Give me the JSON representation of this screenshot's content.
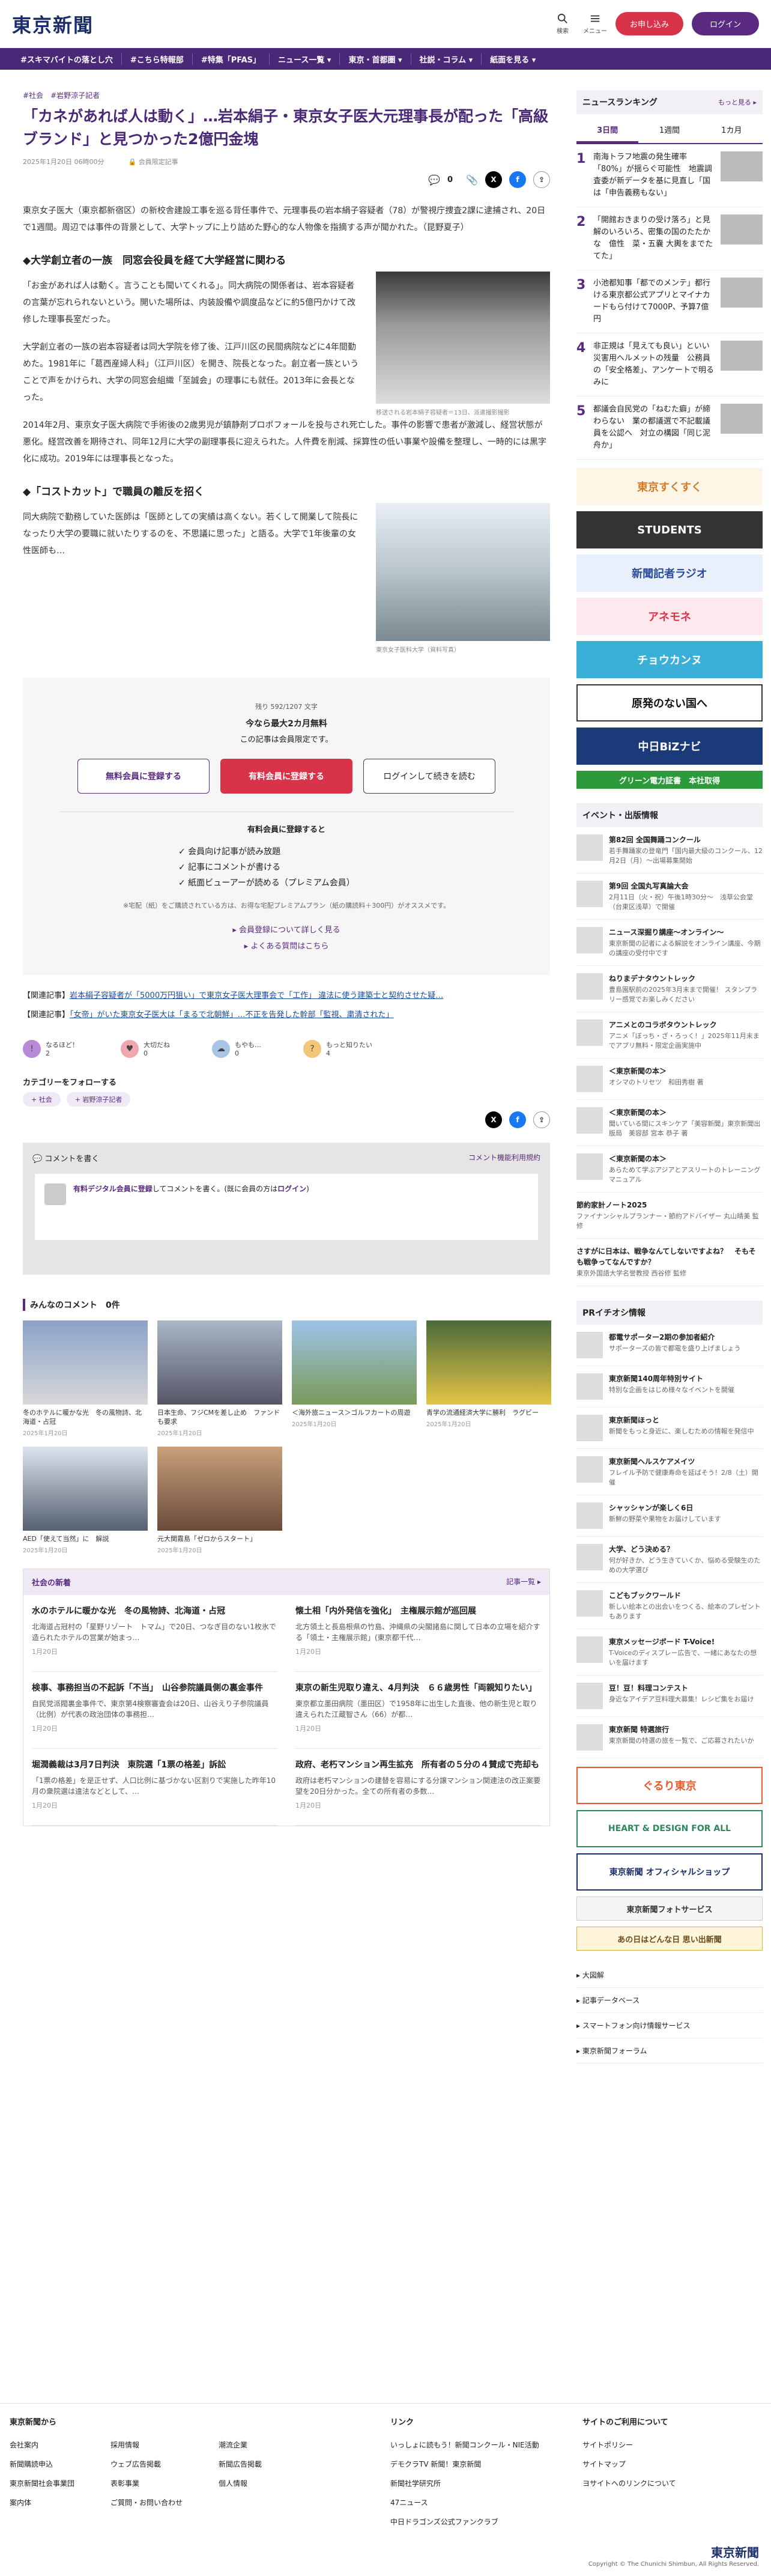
{
  "header": {
    "logo": "東京新聞",
    "icons": [
      {
        "label": "検索",
        "icon": "search-icon"
      },
      {
        "label": "メニュー",
        "icon": "menu-icon"
      }
    ],
    "register": "お申し込み",
    "login": "ログイン"
  },
  "nav": [
    "#スキマバイトの落とし穴",
    "#こちら特報部",
    "#特集「PFAS」",
    "ニュース一覧 ▾",
    "東京・首都圏 ▾",
    "社説・コラム ▾",
    "紙面を見る ▾"
  ],
  "article": {
    "tags": [
      "#社会",
      "#岩野涼子記者"
    ],
    "title": "「カネがあれば人は動く」…岩本絹子・東京女子医大元理事長が配った「高級ブランド」と見つかった2億円金塊",
    "date": "2025年1月20日 06時00分",
    "author": "会員限定記事",
    "count": "0",
    "lead": "東京女子医大（東京都新宿区）の新校舎建設工事を巡る背任事件で、元理事長の岩本絹子容疑者（78）が警視庁捜査2課に逮捕され、20日で1週間。周辺では事件の背景として、大学トップに上り詰めた野心的な人物像を指摘する声が聞かれた。（昆野夏子）",
    "h2a": "◆大学創立者の一族　同窓会役員を経て大学経営に関わる",
    "p1": "「お金があれば人は動く。言うことも聞いてくれる」。同大病院の関係者は、岩本容疑者の言葉が忘れられないという。開いた場所は、内装設備や調度品などに約5億円かけて改修した理事長室だった。",
    "p2": "大学創立者の一族の岩本容疑者は同大学院を修了後、江戸川区の民間病院などに4年間勤めた。1981年に「葛西産婦人科」（江戸川区）を開き、院長となった。創立者一族ということで声をかけられ、大学の同窓会組織「至誠会」の理事にも就任。2013年に会長となった。",
    "p3": "2014年2月、東京女子医大病院で手術後の2歳男児が鎮静剤プロポフォールを投与され死亡した。事件の影響で患者が激減し、経営状態が悪化。経営改善を期待され、同年12月に大学の副理事長に迎えられた。人件費を削減、採算性の低い事業や設備を整理し、一時的には黒字化に成功。2019年には理事長となった。",
    "fig1cap": "移送される岩本絹子容疑者＝13日、派遣撮影撮影",
    "h2b": "◆「コストカット」で職員の離反を招く",
    "p4": "同大病院で勤務していた医師は「医師としての実績は高くない。若くして開業して院長になったり大学の要職に就いたりするのを、不思議に思った」と語る。大学で1年後輩の女性医師も…",
    "fig2cap": "東京女子医科大学（資料写真）"
  },
  "paywall": {
    "remain": "残り 592/1207 文字",
    "offer": "今なら最大2カ月無料",
    "note": "この記事は会員限定です。",
    "b1": "無料会員に登録する",
    "b2": "有料会員に登録する",
    "b3": "ログインして続きを読む",
    "bh": "有料会員に登録すると",
    "benefits": [
      "✓ 会員向け記事が読み放題",
      "✓ 記事にコメントが書ける",
      "✓ 紙面ビューアーが読める（プレミアム会員）"
    ],
    "small": "※宅配（紙）をご購読されている方は、お得な宅配プレミアムプラン（紙の購読料＋300円）がオススメです。",
    "l1": "▸ 会員登録について詳しく見る",
    "l2": "▸ よくある質問はこちら"
  },
  "related": [
    {
      "k": "【関連記事】",
      "t": "岩本絹子容疑者が「5000万円狙い」で東京女子医大理事会で「工作」 違法に使う建築士と契約させた疑…"
    },
    {
      "k": "【関連記事】",
      "t": "「女帝」がいた東京女子医大は「まるで北朝鮮」…不正を告発した幹部「監視、粛清された」"
    }
  ],
  "reactions": [
    {
      "l": "なるほど！",
      "c": "2",
      "icon": "lightbulb-icon",
      "color": "#b88ad6"
    },
    {
      "l": "大切だね",
      "c": "0",
      "icon": "heart-icon",
      "color": "#f0a7b0"
    },
    {
      "l": "もやも…",
      "c": "0",
      "icon": "cloud-icon",
      "color": "#a9c5e6"
    },
    {
      "l": "もっと知りたい",
      "c": "4",
      "icon": "question-icon",
      "color": "#f3c77a"
    }
  ],
  "follow": {
    "title": "カテゴリーをフォローする",
    "cats": [
      "+ 社会",
      "+ 岩野涼子記者"
    ]
  },
  "comments": {
    "title": "コメントを書く",
    "rule": "コメント機能利用規約",
    "pre": "有料デジタル会員に登録",
    "mid": "してコメントを書く。(既に会員の方は",
    "login": "ログイン",
    "post": ")",
    "all": "みんなのコメント　0件"
  },
  "photos": [
    {
      "t": "冬のホテルに暖かな光　冬の風物詩、北海道・占冠",
      "d": "2025年1月20日"
    },
    {
      "t": "日本生命、フジCMを差し止め　ファンドも要求",
      "d": "2025年1月20日"
    },
    {
      "t": "＜海外旅ニュース＞ゴルフカートの周遊",
      "d": "2025年1月20日"
    },
    {
      "t": "青学の流通経済大学に勝利　ラグビー",
      "d": "2025年1月20日"
    },
    {
      "t": "AED「使えて当然」に　解説",
      "d": "2025年1月20日"
    },
    {
      "t": "元大関霧島「ゼロからスタート」",
      "d": "2025年1月20日"
    }
  ],
  "social": {
    "title": "社会の新着",
    "more": "記事一覧 ▸",
    "items": [
      {
        "t": "水のホテルに暖かな光　冬の風物詩、北海道・占冠",
        "b": "北海道占冠村の「星野リゾート　トマム」で20日、つなぎ目のない1枚氷で造られたホテルの営業が始まっ…",
        "d": "1月20日"
      },
      {
        "t": "懐土相「内外発信を強化」　主権展示館が巡回展",
        "b": "北方領土と長島根県の竹島、沖縄県の尖閣諸島に関して日本の立場を紹介する「領土・主権展示館」(東京都千代…",
        "d": "1月20日"
      },
      {
        "t": "検事、事務担当の不起訴「不当」　山谷参院議員側の裏金事件",
        "b": "自民党派閥裏金事件で、東京第4検察審査会は20日、山谷えり子参院議員（比例）が代表の政治団体の事務担…",
        "d": "1月20日"
      },
      {
        "t": "東京の新生児取り違え、4月判決　６６歳男性「両親知りたい」",
        "b": "東京都立墨田病院（墨田区）で1958年に出生した直後、他の新生児と取り違えられた江蔵智さん（66）が都…",
        "d": "1月20日"
      },
      {
        "t": "堀潤義裁は3月7日判決　東院選「1票の格差」訴訟",
        "b": "「1票の格差」を是正せず、人口比例に基づかない区割りで実施した昨年10月の衆院選は違法などとして、…",
        "d": "1月20日"
      },
      {
        "t": "政府、老朽マンション再生拡充　所有者の５分の４賛成で売却も",
        "b": "政府は老朽マンションの建替を容易にする分譲マンション関連法の改正案要望を20日分かった。全ての所有者の多数…",
        "d": "1月20日"
      }
    ]
  },
  "sidebar": {
    "rank_title": "ニュースランキング",
    "rank_more": "もっと見る ▸",
    "tabs": [
      "3日間",
      "1週間",
      "1カ月"
    ],
    "ranks": [
      {
        "n": "1",
        "t": "南海トラフ地震の発生確率「80%」が揺らぐ可能性　地震調査委が新データを基に見直し「国は「申告義務もない」"
      },
      {
        "n": "2",
        "t": "「開館おきまりの受け落ろ」と見解のいろいろ、密集の国のたたかな　億性　菜・五嚢 大輿をまでたてた」"
      },
      {
        "n": "3",
        "t": "小池都知事「都でのメンテ」都行ける東京都公式アプリとマイナカードもら付けて7000P、予算7億円"
      },
      {
        "n": "4",
        "t": "非正規は「見えても良い」といい災害用へルメットの残量　公務員の「安全格差」、アンケートで明るみに"
      },
      {
        "n": "5",
        "t": "都議会自民党の「ねむた癖」が締わらない　業の都議選で不記載議員を公認へ　対立の構図「同じ泥舟か」"
      }
    ],
    "banners": [
      "東京すくすく",
      "STUDENTS",
      "新聞記者ラジオ",
      "アネモネ",
      "チョウカンヌ",
      "原発のない国へ",
      "中日BiZナビ",
      "グリーン電力証書　本社取得"
    ],
    "ev_title": "イベント・出版情報",
    "events": [
      {
        "t": "第82回 全国舞踊コンクール",
        "s": "若手舞踊家の登竜門「国内最大級のコンクール、12月2日（月）～出場募集開始"
      },
      {
        "t": "第9回 全国丸写真論大会",
        "s": "2月11日（火・祝）午後1時30分～　浅草公会堂（台東区浅草）で開催"
      },
      {
        "t": "ニュース深掘り講座〜オンライン〜",
        "s": "東京新聞の記者による解説をオンライン講座、今期の講座の受付中です"
      },
      {
        "t": "ねりまデナタウントレック",
        "s": "豊島園駅前の2025年3月末まで開催！ スタンプラリー感覚でお楽しみください"
      },
      {
        "t": "アニメとのコラボタウントレック",
        "s": "アニメ「ぼっち・ざ・ろっく！」2025年11月末までアプリ無料・限定企画実施中"
      },
      {
        "t": "＜東京新聞の本＞",
        "s": "オシマのトリセツ　和田秀樹 著"
      },
      {
        "t": "＜東京新聞の本＞",
        "s": "聞いている間にスキンケア「美容新聞」東京新聞出版局　美容部 宮本 恭子 著"
      },
      {
        "t": "＜東京新聞の本＞",
        "s": "あらためて学ぶアジアとアスリートのトレーニングマニュアル"
      },
      {
        "t": "節約家計ノート2025",
        "s": "ファイナンシャルプランナー・節約アドバイザー 丸山晴美 監修"
      },
      {
        "t": "さすがに日本は、戦争なんてしないですよね？　そもそも戦争ってなんですか？",
        "s": "東京外国語大学名誉教授 西谷修 監修"
      }
    ],
    "pr_title": "PRイチオシ情報",
    "prs": [
      {
        "t": "都電サポーター2期の参加者紹介",
        "s": "サポーターズの皆で都電を盛り上げましょう"
      },
      {
        "t": "東京新聞140周年特別サイト",
        "s": "特別な企画をはじめ様々なイベントを開催"
      },
      {
        "t": "東京新聞ほっと",
        "s": "新聞をもっと身近に、楽しむための情報を発信中"
      },
      {
        "t": "東京新聞ヘルスケアメイツ",
        "s": "フレイル予防で健康寿命を延ばそう！2/8（土）開催"
      },
      {
        "t": "シャッシャンが楽しく6日",
        "s": "新鮮の野菜や果物をお届けしています"
      },
      {
        "t": "大学、どう決める？",
        "s": "何が好きか、どう生きていくか、悩める受験生のための大学選び"
      },
      {
        "t": "こどもブックワールド",
        "s": "新しい絵本との出会いをつくる、絵本のプレゼントもあります"
      },
      {
        "t": "東京メッセージボード T-Voice!",
        "s": "T-Voiceのディスプレー広告で、一緒にあなたの想いを届けます"
      },
      {
        "t": "豆！豆！料理コンテスト",
        "s": "身近なアイデア豆料理大募集！レシピ集をお届け"
      },
      {
        "t": "東京新聞 特選旅行",
        "s": "東京新聞の特選の旅を一覧で、ご応募されたいか"
      }
    ],
    "banners2": [
      "ぐるり東京",
      "HEART & DESIGN FOR ALL",
      "東京新聞 オフィシャルショップ",
      "東京新聞フォトサービス",
      "あの日はどんな日 思い出新聞"
    ],
    "links": [
      "▸ 大図解",
      "▸ 記事データベース",
      "▸ スマートフォン向け情報サービス",
      "▸ 東京新聞フォーラム"
    ]
  },
  "footer": {
    "c1t": "東京新聞から",
    "c1": [
      "会社案内",
      "新聞購読申込",
      "東京新聞社会事業団",
      "案内体"
    ],
    "c1b": [
      "採用情報",
      "ウェブ広告掲載",
      "表彰事業",
      "ご質問・お問い合わせ"
    ],
    "c1c": [
      "潮流企業",
      "新聞広告掲載",
      "個人情報"
    ],
    "c2t": "リンク",
    "c2": [
      "いっしょに読もう！新聞コンクール・NIE活動",
      "デモクラTV 新聞！東京新聞",
      "新聞社学研究所",
      "47ニュース",
      "中日ドラゴンズ公式ファンクラブ"
    ],
    "c3t": "サイトのご利用について",
    "c3": [
      "サイトポリシー",
      "サイトマップ",
      "ヨサイトへのリンクについて"
    ],
    "copy": "Copyright © The Chunichi Shimbun, All Rights Reserved."
  },
  "colors": {
    "brand": "#4a2878",
    "accent": "#d9334a"
  }
}
